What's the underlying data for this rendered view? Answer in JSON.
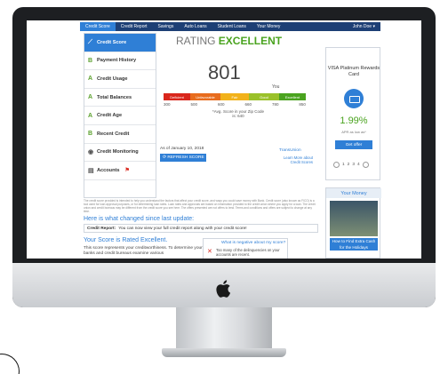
{
  "nav": {
    "items": [
      "Credit Score",
      "Credit Report",
      "Savings",
      "Auto Loans",
      "Student Loans",
      "Your Money"
    ],
    "active_index": 0,
    "user": "John Doe ▾"
  },
  "sidebar": {
    "items": [
      {
        "grade": "",
        "label": "Credit Score",
        "icon": "chart-icon"
      },
      {
        "grade": "B",
        "label": "Payment History"
      },
      {
        "grade": "A",
        "label": "Credit Usage"
      },
      {
        "grade": "A",
        "label": "Total Balances"
      },
      {
        "grade": "A",
        "label": "Credit Age"
      },
      {
        "grade": "B",
        "label": "Recent Credit"
      },
      {
        "grade": "",
        "label": "Credit Monitoring",
        "icon": "monitor-icon"
      },
      {
        "grade": "",
        "label": "Accounts",
        "icon": "accounts-icon",
        "flag": "⚑"
      }
    ]
  },
  "rating": {
    "prefix": "RATING",
    "value": "EXCELLENT"
  },
  "score": "801",
  "you_label": "You",
  "score_scale": {
    "segments": [
      {
        "label": "Deficient",
        "color": "#d9261c"
      },
      {
        "label": "Unfavorable",
        "color": "#e86c1d"
      },
      {
        "label": "Fair",
        "color": "#f2b21a"
      },
      {
        "label": "Good",
        "color": "#9ac12a"
      },
      {
        "label": "Excellent",
        "color": "#4aa31f"
      }
    ],
    "ticks": [
      "300",
      "500",
      "600",
      "660",
      "780",
      "850"
    ]
  },
  "zip_note": "*Avg. Score in your Zip Code is: 640",
  "as_of": "As of January 10, 2018",
  "refresh_label": "⟳ REFRESH SCORE",
  "bureau": "TransUnion",
  "learn_more": "Learn More about Credit Scores",
  "offer": {
    "title": "VISA Platinum Rewards Card",
    "rate": "1.99%",
    "rate_note": "APR as low as*",
    "button": "Get offer",
    "pages": [
      "1",
      "2",
      "3",
      "4"
    ]
  },
  "fine_print": "The credit score provided is intended to help you understand the factors that affect your credit score, and ways you could save money with Bank. Credit score (also known as FICO) is a tool used for loan approval purposes, or for determining loan rates. Loan rates and approvals are based on information provided to the credit union where you apply for a loan. The credit union and credit bureaus may be different from the credit score you see here. The offers presented are not offers to lend. Terms and conditions and offers are subject to change at any time.",
  "changed": {
    "heading": "Here is what changed since last update:",
    "label": "Credit Report:",
    "text": "You can now view your full credit report along with your credit score!"
  },
  "rated": {
    "heading": "Your Score is Rated Excellent.",
    "text": "This score represents your creditworthiness. To determine your score, banks and credit bureaus examine various"
  },
  "negative": {
    "heading": "What is negative about my score?",
    "text": "Too many of the delinquencies on your accounts are recent."
  },
  "your_money": {
    "heading": "Your Money",
    "caption": "How to Find Extra Cash for the Holidays"
  }
}
